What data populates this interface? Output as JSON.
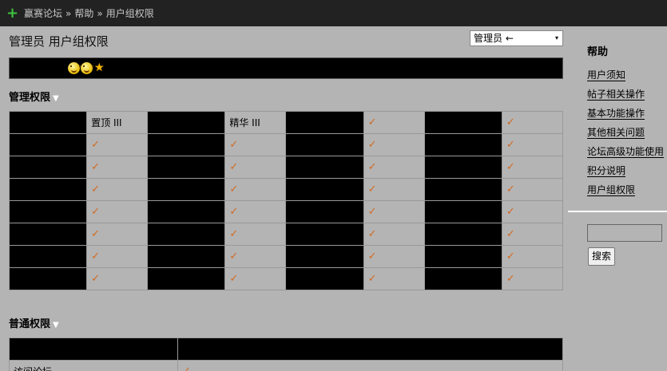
{
  "breadcrumb": {
    "home_icon": "plus-icon",
    "items": [
      "赢赛论坛",
      "帮助",
      "用户组权限"
    ],
    "separator": "»"
  },
  "page": {
    "title": "管理员 用户组权限",
    "group_select": {
      "value": "管理员 ←",
      "caret": "▾"
    }
  },
  "banner": {
    "icons": [
      "smiley-icon",
      "smiley-icon",
      "star-icon"
    ]
  },
  "admin_section": {
    "title": "管理权限",
    "toggle_icon": "▼",
    "rows": [
      [
        "",
        "置顶 III",
        "",
        "精华 III",
        "",
        "✓",
        "",
        "✓"
      ],
      [
        "",
        "✓",
        "",
        "✓",
        "",
        "✓",
        "",
        "✓"
      ],
      [
        "",
        "✓",
        "",
        "✓",
        "",
        "✓",
        "",
        "✓"
      ],
      [
        "",
        "✓",
        "",
        "✓",
        "",
        "✓",
        "",
        "✓"
      ],
      [
        "",
        "✓",
        "",
        "✓",
        "",
        "✓",
        "",
        "✓"
      ],
      [
        "",
        "✓",
        "",
        "✓",
        "",
        "✓",
        "",
        "✓"
      ],
      [
        "",
        "✓",
        "",
        "✓",
        "",
        "✓",
        "",
        "✓"
      ],
      [
        "",
        "✓",
        "",
        "✓",
        "",
        "✓",
        "",
        "✓"
      ]
    ]
  },
  "normal_section": {
    "title": "普通权限",
    "toggle_icon": "▼",
    "rows": [
      [
        "访问论坛",
        "✓"
      ]
    ]
  },
  "sidebar": {
    "title": "帮助",
    "links": [
      "用户须知",
      "帖子相关操作",
      "基本功能操作",
      "其他相关问题",
      "论坛高级功能使用",
      "积分说明",
      "用户组权限"
    ],
    "search_value": "",
    "search_button": "搜索"
  },
  "colors": {
    "topbar": "#222222",
    "background": "#b4b4b4",
    "check": "#d2691e",
    "plus": "#3ec43e"
  }
}
